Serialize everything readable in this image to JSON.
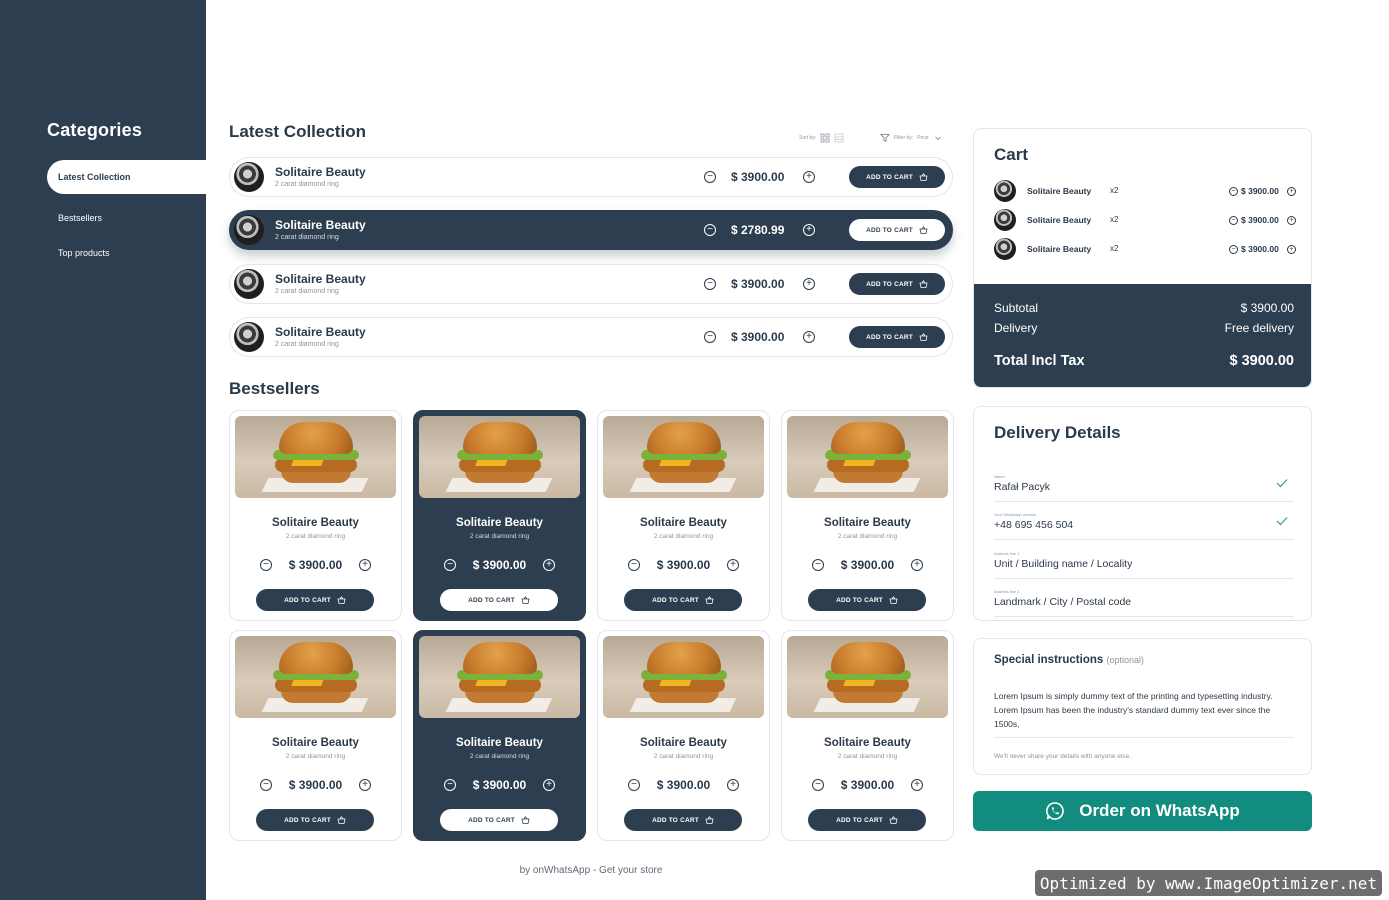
{
  "sidebar": {
    "title": "Categories",
    "items": [
      {
        "label": "Latest Collection",
        "active": true
      },
      {
        "label": "Bestsellers",
        "active": false
      },
      {
        "label": "Top products",
        "active": false
      }
    ]
  },
  "latest": {
    "title": "Latest Collection",
    "sort_label": "Sort by:",
    "filter_label": "Filter by:",
    "filter_value": "Price",
    "items": [
      {
        "name": "Solitaire Beauty",
        "sub": "2 carat diamond ring",
        "price": "$ 3900.00",
        "cta": "ADD TO CART",
        "highlighted": false
      },
      {
        "name": "Solitaire Beauty",
        "sub": "2 carat diamond ring",
        "price": "$ 2780.99",
        "cta": "ADD TO CART",
        "highlighted": true
      },
      {
        "name": "Solitaire Beauty",
        "sub": "2 carat diamond ring",
        "price": "$ 3900.00",
        "cta": "ADD TO CART",
        "highlighted": false
      },
      {
        "name": "Solitaire Beauty",
        "sub": "2 carat diamond ring",
        "price": "$ 3900.00",
        "cta": "ADD TO CART",
        "highlighted": false
      }
    ]
  },
  "bestsellers": {
    "title": "Bestsellers",
    "cards": [
      {
        "name": "Solitaire Beauty",
        "sub": "2 carat diamond ring",
        "price": "$ 3900.00",
        "cta": "ADD TO CART",
        "highlighted": false
      },
      {
        "name": "Solitaire Beauty",
        "sub": "2 carat diamond ring",
        "price": "$ 3900.00",
        "cta": "ADD TO CART",
        "highlighted": true
      },
      {
        "name": "Solitaire Beauty",
        "sub": "2 carat diamond ring",
        "price": "$ 3900.00",
        "cta": "ADD TO CART",
        "highlighted": false
      },
      {
        "name": "Solitaire Beauty",
        "sub": "2 carat diamond ring",
        "price": "$ 3900.00",
        "cta": "ADD TO CART",
        "highlighted": false
      },
      {
        "name": "Solitaire Beauty",
        "sub": "2 carat diamond ring",
        "price": "$ 3900.00",
        "cta": "ADD TO CART",
        "highlighted": false
      },
      {
        "name": "Solitaire Beauty",
        "sub": "2 carat diamond ring",
        "price": "$ 3900.00",
        "cta": "ADD TO CART",
        "highlighted": true
      },
      {
        "name": "Solitaire Beauty",
        "sub": "2 carat diamond ring",
        "price": "$ 3900.00",
        "cta": "ADD TO CART",
        "highlighted": false
      },
      {
        "name": "Solitaire Beauty",
        "sub": "2 carat diamond ring",
        "price": "$ 3900.00",
        "cta": "ADD TO CART",
        "highlighted": false
      }
    ]
  },
  "cart": {
    "title": "Cart",
    "lines": [
      {
        "name": "Solitaire Beauty",
        "qty": "x2",
        "price": "$ 3900.00"
      },
      {
        "name": "Solitaire Beauty",
        "qty": "x2",
        "price": "$ 3900.00"
      },
      {
        "name": "Solitaire Beauty",
        "qty": "x2",
        "price": "$ 3900.00"
      }
    ],
    "subtotal_label": "Subtotal",
    "subtotal_value": "$ 3900.00",
    "delivery_label": "Delivery",
    "delivery_value": "Free delivery",
    "total_label": "Total Incl Tax",
    "total_value": "$ 3900.00"
  },
  "delivery": {
    "title": "Delivery Details",
    "fields": [
      {
        "label": "Name",
        "value": "Rafał Pacyk",
        "valid": true
      },
      {
        "label": "Your WhatsApp number",
        "value": "+48 695 456 504",
        "valid": true
      },
      {
        "label": "Address line 1",
        "value": "Unit / Building name / Locality",
        "valid": false
      },
      {
        "label": "Address line 2",
        "value": "Landmark / City / Postal code",
        "valid": false
      }
    ]
  },
  "instructions": {
    "title": "Special instructions",
    "optional": "(optional)",
    "text": "Lorem Ipsum is simply dummy text of the printing and typesetting industry. Lorem Ipsum has been the industry's standard dummy text ever since the 1500s,",
    "note": "We'll never share your details with anyone else."
  },
  "whatsapp_button": "Order on WhatsApp",
  "footer": "by onWhatsApp - Get your store",
  "watermark": "Optimized by www.ImageOptimizer.net",
  "colors": {
    "navy": "#2d3e50",
    "whatsapp": "#128c7e",
    "check": "#2eaa55"
  }
}
